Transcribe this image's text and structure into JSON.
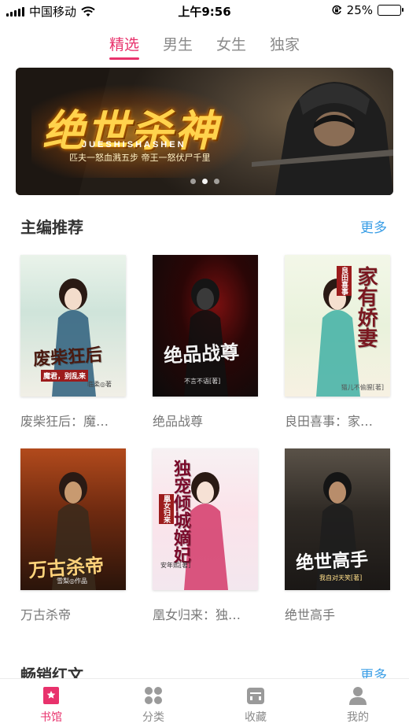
{
  "status_bar": {
    "carrier": "中国移动",
    "time": "上午9:56",
    "battery": "25%",
    "battery_level": 0.25
  },
  "tabs": [
    {
      "label": "精选",
      "active": true
    },
    {
      "label": "男生",
      "active": false
    },
    {
      "label": "女生",
      "active": false
    },
    {
      "label": "独家",
      "active": false
    }
  ],
  "banner": {
    "title": "绝世杀神",
    "subtitle": "JUESHISHASHEN",
    "tagline": "匹夫一怒血溅五步 帝王一怒伏尸千里",
    "page_count": 3,
    "active_page": 2
  },
  "editor_picks": {
    "title": "主编推荐",
    "more": "更多",
    "books": [
      {
        "name": "废柴狂后：魔…",
        "cover_title": "废柴狂后",
        "cover_sub": "魔君，别乱来",
        "cover_author": "临柔◎著"
      },
      {
        "name": "绝品战尊",
        "cover_title": "绝品战尊",
        "cover_sub": "",
        "cover_author": "不言不语[著]"
      },
      {
        "name": "良田喜事：家…",
        "cover_title": "家有娇妻",
        "cover_sub": "良田喜事",
        "cover_author": "猫儿不偷腥[著]"
      },
      {
        "name": "万古杀帝",
        "cover_title": "万古杀帝",
        "cover_sub": "",
        "cover_author": "雪梨◎作品"
      },
      {
        "name": "凰女归来：独…",
        "cover_title": "独宠倾城嫡妃",
        "cover_sub": "凰女归来",
        "cover_author": "安年熙[著]"
      },
      {
        "name": "绝世高手",
        "cover_title": "绝世高手",
        "cover_sub": "",
        "cover_author": "我自对天笑[著]"
      }
    ]
  },
  "bestsellers": {
    "title": "畅销红文",
    "more": "更多"
  },
  "bottom_nav": [
    {
      "label": "书馆",
      "icon": "bookmark-icon",
      "active": true
    },
    {
      "label": "分类",
      "icon": "grid-icon",
      "active": false
    },
    {
      "label": "收藏",
      "icon": "shelf-icon",
      "active": false
    },
    {
      "label": "我的",
      "icon": "person-icon",
      "active": false
    }
  ],
  "colors": {
    "accent": "#e8326c",
    "link": "#3a9ee6"
  }
}
